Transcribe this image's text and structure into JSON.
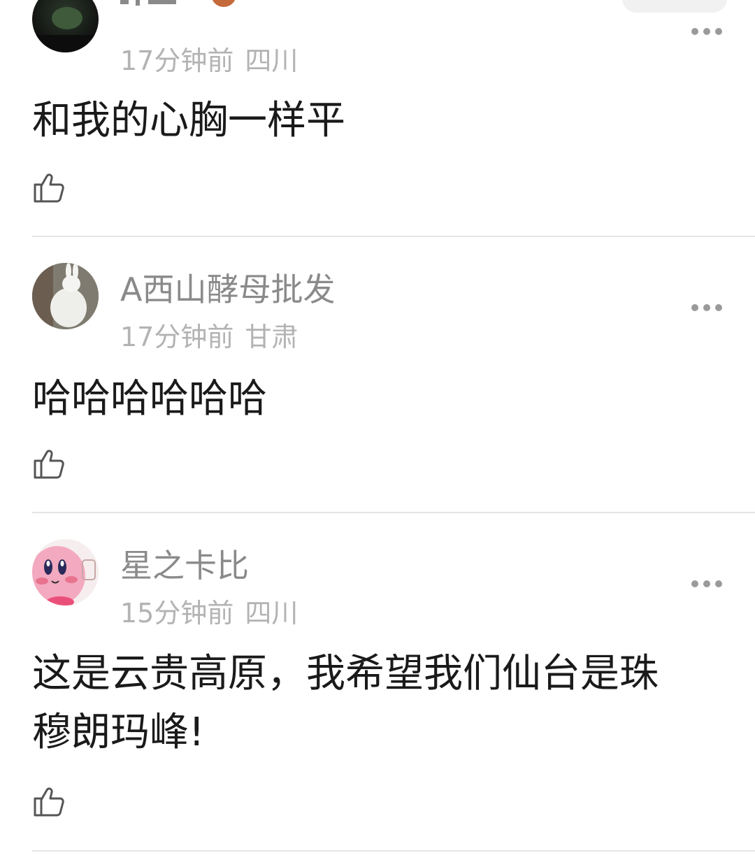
{
  "comments": [
    {
      "avatar": "dark-avatar",
      "time": "17分钟前",
      "location": "四川",
      "text": "和我的心胸一样平",
      "like_icon": "thumbs-up-icon",
      "more_icon": "more-dots-icon"
    },
    {
      "avatar": "white-rabbit-avatar",
      "username": "A西山酵母批发",
      "time": "17分钟前",
      "location": "甘肃",
      "text": "哈哈哈哈哈哈",
      "like_icon": "thumbs-up-icon",
      "more_icon": "more-dots-icon"
    },
    {
      "avatar": "kirby-avatar",
      "username": "星之卡比",
      "time": "15分钟前",
      "location": "四川",
      "text": "这是云贵高原，我希望我们仙台是珠穆朗玛峰!",
      "like_icon": "thumbs-up-icon",
      "more_icon": "more-dots-icon"
    }
  ],
  "colors": {
    "username": "#8a8a8a",
    "meta": "#b3b3b3",
    "text": "#1a1a1a",
    "divider": "#e5e5e5"
  }
}
